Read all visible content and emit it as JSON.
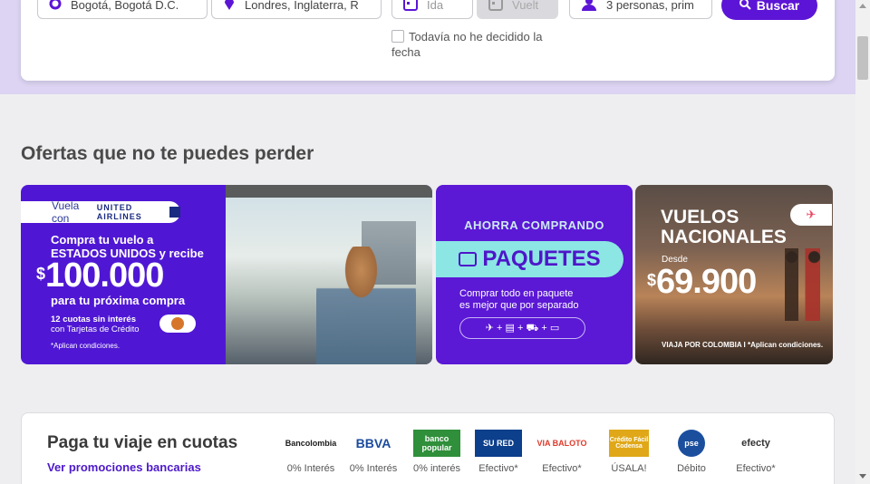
{
  "search": {
    "origin": "Bogotá, Bogotá D.C.",
    "destination": "Londres, Inglaterra, R",
    "departure_placeholder": "Ida",
    "return_placeholder": "Vuelt",
    "passengers": "3 personas, prim",
    "search_button": "Buscar",
    "undecided_label": "Todavía no he decidido la fecha"
  },
  "offers": {
    "title": "Ofertas que no te puedes perder",
    "united": {
      "tag": "Vuela con",
      "brand": "UNITED AIRLINES",
      "line1": "Compra tu vuelo a",
      "line2": "ESTADOS UNIDOS y recibe",
      "currency": "$",
      "amount": "100.000",
      "line3": "para tu próxima compra",
      "cuotas1": "12 cuotas sin interés",
      "cuotas2": "con Tarjetas de Crédito",
      "note": "*Aplican condiciones."
    },
    "paquetes": {
      "heading": "AHORRA COMPRANDO",
      "title": "PAQUETES",
      "text1": "Comprar todo en paquete",
      "text2": "es mejor que por separado",
      "icons": "✈ + ▤ + ⛟ + ▭"
    },
    "nacionales": {
      "title1": "VUELOS",
      "title2": "NACIONALES",
      "desde": "Desde",
      "currency": "$",
      "amount": "69.900",
      "footer": "VIAJA POR COLOMBIA I *Aplican condiciones."
    }
  },
  "payments": {
    "title": "Paga tu viaje en cuotas",
    "link": "Ver promociones bancarias",
    "methods": [
      {
        "logo": "Bancolombia",
        "label": "0% Interés",
        "color": "#1a1a1a"
      },
      {
        "logo": "BBVA",
        "label": "0% Interés",
        "color": "#1b4b9e"
      },
      {
        "logo": "banco popular",
        "label": "0% interés",
        "color": "#2f8f3a"
      },
      {
        "logo": "SU RED",
        "label": "Efectivo*",
        "color": "#0c3f8c"
      },
      {
        "logo": "VIA BALOTO",
        "label": "Efectivo*",
        "color": "#e03a2a"
      },
      {
        "logo": "Crédito Fácil Codensa",
        "label": "ÚSALA!",
        "color": "#e0a818"
      },
      {
        "logo": "pse",
        "label": "Débito",
        "color": "#1b4f9e"
      },
      {
        "logo": "efecty",
        "label": "Efectivo*",
        "color": "#333333"
      }
    ]
  }
}
